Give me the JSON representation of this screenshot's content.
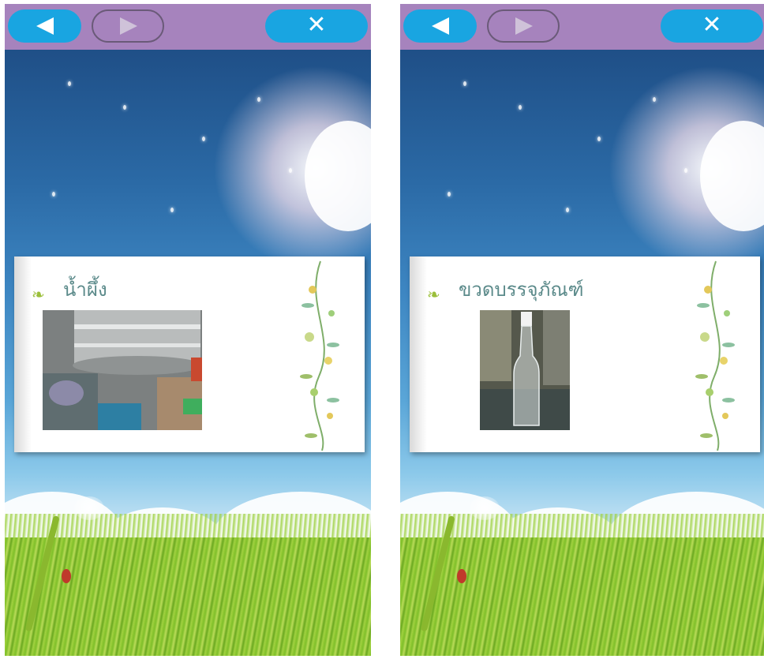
{
  "screens": [
    {
      "title": "น้ำผึ้ง",
      "toolbar": {
        "back_icon": "back-triangle-icon",
        "next_icon": "next-triangle-icon",
        "close_label": "✕"
      },
      "photo_subject": "honey-processing-tank"
    },
    {
      "title": "ขวดบรรจุภัณฑ์",
      "toolbar": {
        "back_icon": "back-triangle-icon",
        "next_icon": "next-triangle-icon",
        "close_label": "✕"
      },
      "photo_subject": "glass-bottle"
    }
  ],
  "colors": {
    "toolbar_bg": "#a683bd",
    "button_blue": "#19a5e1",
    "title_text": "#5b8a8a"
  }
}
